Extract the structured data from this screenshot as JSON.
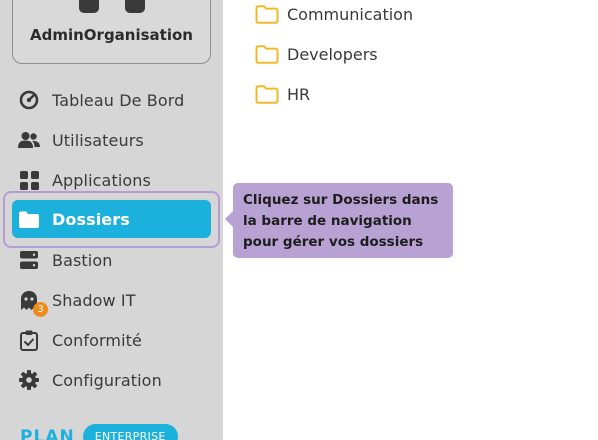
{
  "org": {
    "name": "AdminOrganisation",
    "logo_icon": "organisation-logo-icon"
  },
  "sidebar": {
    "items": [
      {
        "label": "Tableau De Bord",
        "icon": "dashboard-gauge-icon"
      },
      {
        "label": "Utilisateurs",
        "icon": "users-icon"
      },
      {
        "label": "Applications",
        "icon": "apps-grid-icon"
      },
      {
        "label": "Dossiers",
        "icon": "folder-icon",
        "active": true
      },
      {
        "label": "Bastion",
        "icon": "server-icon"
      },
      {
        "label": "Shadow IT",
        "icon": "ghost-icon",
        "badge": "3"
      },
      {
        "label": "Conformité",
        "icon": "clipboard-check-icon"
      },
      {
        "label": "Configuration",
        "icon": "gear-icon"
      }
    ],
    "plan_label": "PLAN",
    "plan_tier": "ENTERPRISE"
  },
  "folders": [
    {
      "name": "Communication"
    },
    {
      "name": "Developers"
    },
    {
      "name": "HR"
    }
  ],
  "tooltip": {
    "text": "Cliquez sur Dossiers dans la barre de navigation pour gérer vos dossiers"
  },
  "colors": {
    "accent": "#1cb1dc",
    "sidebar_bg": "#d6d6d6",
    "tooltip_bg": "#b8a1d3",
    "highlight_ring": "#b59cd6",
    "badge": "#f08a1c",
    "folder_icon": "#f2b829"
  }
}
